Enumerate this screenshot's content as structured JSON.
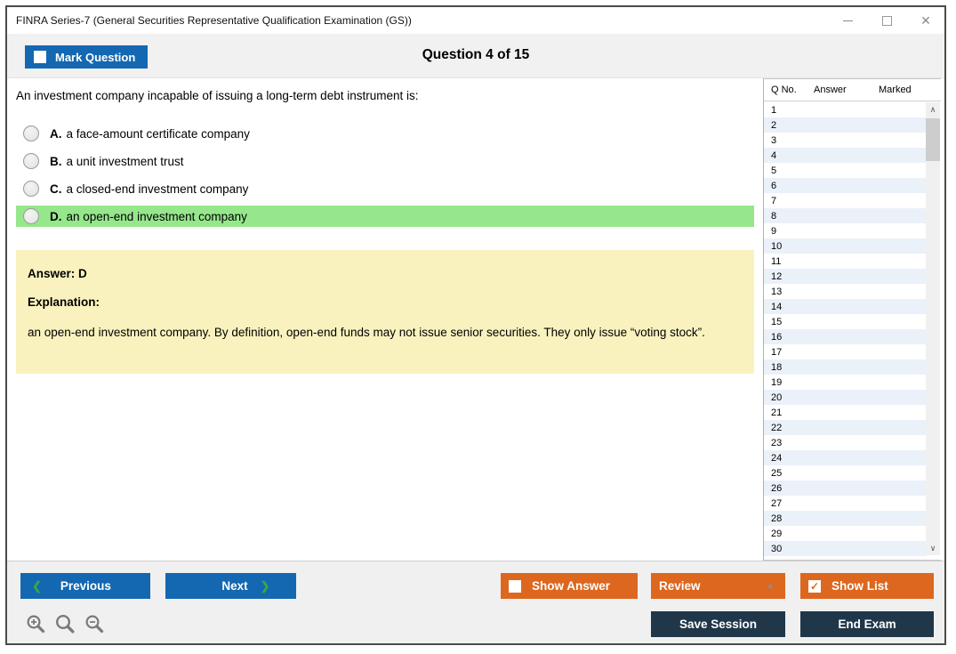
{
  "window": {
    "title": "FINRA Series-7 (General Securities Representative Qualification Examination (GS))"
  },
  "header": {
    "mark_question_label": "Mark Question",
    "mark_question_checked": false,
    "question_counter": "Question 4 of 15"
  },
  "question": {
    "text": "An investment company incapable of issuing a long-term debt instrument is:",
    "options": [
      {
        "letter": "A.",
        "text": "a face-amount certificate company",
        "selected": false,
        "highlighted": false
      },
      {
        "letter": "B.",
        "text": "a unit investment trust",
        "selected": false,
        "highlighted": false
      },
      {
        "letter": "C.",
        "text": "a closed-end investment company",
        "selected": false,
        "highlighted": false
      },
      {
        "letter": "D.",
        "text": "an open-end investment company",
        "selected": false,
        "highlighted": true
      }
    ]
  },
  "answer_panel": {
    "answer_label": "Answer: D",
    "explanation_label": "Explanation:",
    "explanation_text": "an open-end investment company. By definition, open-end funds may not issue senior securities. They only issue “voting stock”."
  },
  "question_list": {
    "columns": [
      "Q No.",
      "Answer",
      "Marked"
    ],
    "rows": [
      {
        "q": "1",
        "answer": "",
        "marked": ""
      },
      {
        "q": "2",
        "answer": "",
        "marked": ""
      },
      {
        "q": "3",
        "answer": "",
        "marked": ""
      },
      {
        "q": "4",
        "answer": "",
        "marked": ""
      },
      {
        "q": "5",
        "answer": "",
        "marked": ""
      },
      {
        "q": "6",
        "answer": "",
        "marked": ""
      },
      {
        "q": "7",
        "answer": "",
        "marked": ""
      },
      {
        "q": "8",
        "answer": "",
        "marked": ""
      },
      {
        "q": "9",
        "answer": "",
        "marked": ""
      },
      {
        "q": "10",
        "answer": "",
        "marked": ""
      },
      {
        "q": "11",
        "answer": "",
        "marked": ""
      },
      {
        "q": "12",
        "answer": "",
        "marked": ""
      },
      {
        "q": "13",
        "answer": "",
        "marked": ""
      },
      {
        "q": "14",
        "answer": "",
        "marked": ""
      },
      {
        "q": "15",
        "answer": "",
        "marked": ""
      },
      {
        "q": "16",
        "answer": "",
        "marked": ""
      },
      {
        "q": "17",
        "answer": "",
        "marked": ""
      },
      {
        "q": "18",
        "answer": "",
        "marked": ""
      },
      {
        "q": "19",
        "answer": "",
        "marked": ""
      },
      {
        "q": "20",
        "answer": "",
        "marked": ""
      },
      {
        "q": "21",
        "answer": "",
        "marked": ""
      },
      {
        "q": "22",
        "answer": "",
        "marked": ""
      },
      {
        "q": "23",
        "answer": "",
        "marked": ""
      },
      {
        "q": "24",
        "answer": "",
        "marked": ""
      },
      {
        "q": "25",
        "answer": "",
        "marked": ""
      },
      {
        "q": "26",
        "answer": "",
        "marked": ""
      },
      {
        "q": "27",
        "answer": "",
        "marked": ""
      },
      {
        "q": "28",
        "answer": "",
        "marked": ""
      },
      {
        "q": "29",
        "answer": "",
        "marked": ""
      },
      {
        "q": "30",
        "answer": "",
        "marked": ""
      }
    ]
  },
  "footer": {
    "previous_label": "Previous",
    "next_label": "Next",
    "show_answer_label": "Show Answer",
    "show_answer_checked": false,
    "review_label": "Review",
    "show_list_label": "Show List",
    "show_list_checked": true,
    "save_session_label": "Save Session",
    "end_exam_label": "End Exam"
  },
  "icons": {
    "minimize": "minimize-dash",
    "maximize": "maximize-square",
    "close": "✕",
    "prev_chevron": "❮",
    "next_chevron": "❯",
    "review_caret": "▲",
    "checkmark": "✓",
    "scroll_up": "∧",
    "scroll_down": "∨",
    "zoom_in": "magnifier-plus",
    "zoom": "magnifier",
    "zoom_out": "magnifier-minus"
  },
  "colors": {
    "primary_blue": "#1368b1",
    "accent_orange": "#dd671f",
    "dark_navy": "#20374a",
    "highlight_green": "#96e78c",
    "explanation_yellow": "#faf2be",
    "alt_row_blue": "#ebf1f9",
    "chevron_green": "#35a845"
  }
}
